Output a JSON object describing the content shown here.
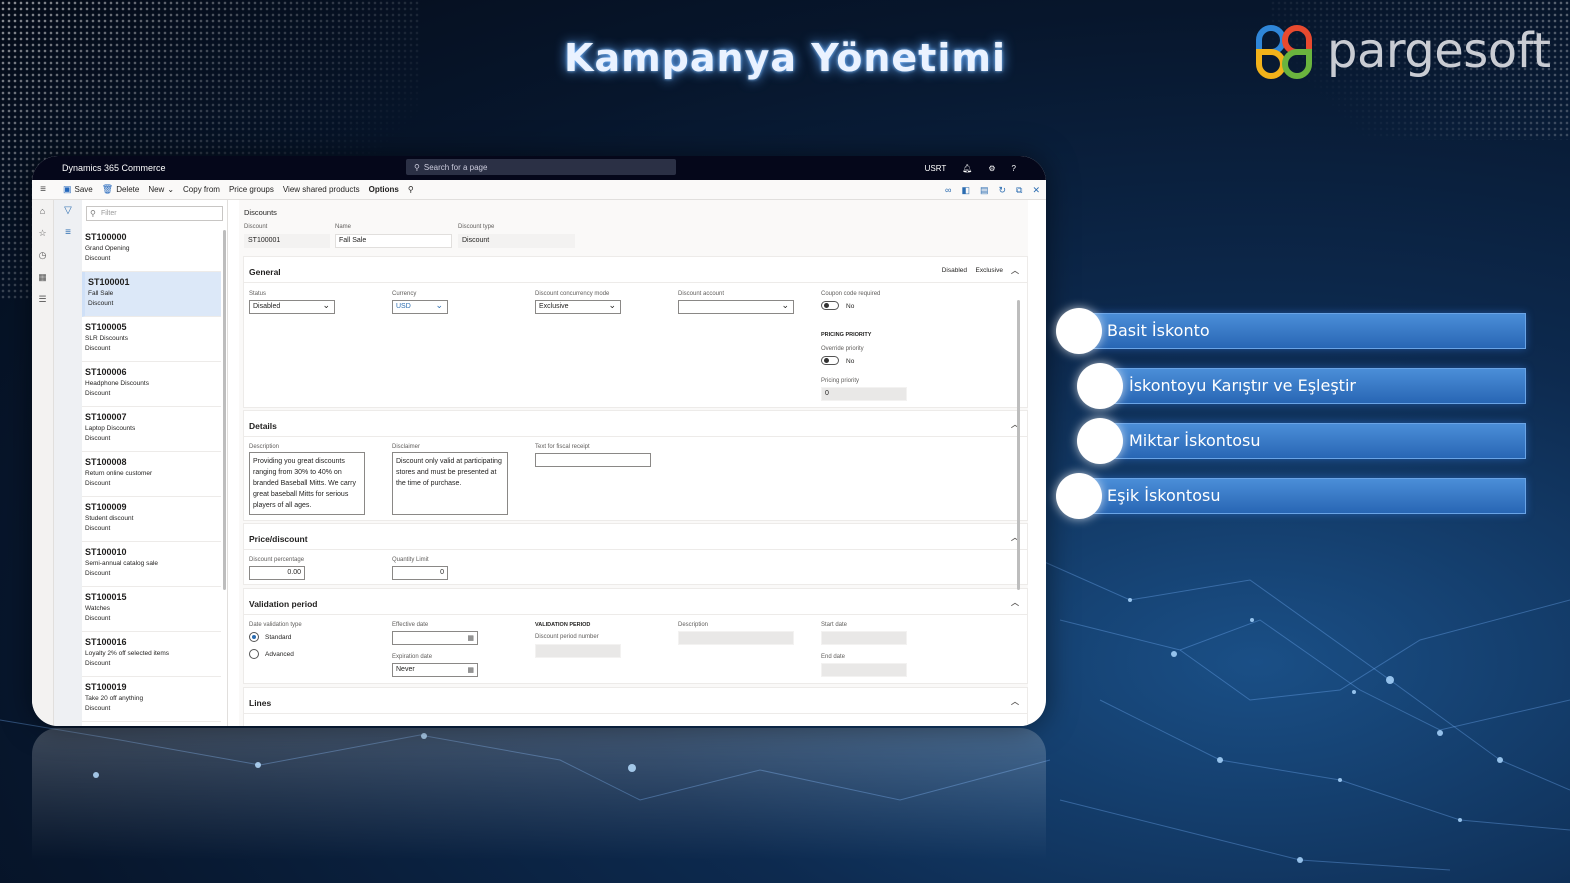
{
  "slide": {
    "title": "Kampanya Yönetimi",
    "logo_text": "pargesoft"
  },
  "app": {
    "name": "Dynamics 365 Commerce",
    "search_placeholder": "Search for a page",
    "user": "USRT"
  },
  "toolbar": {
    "save": "Save",
    "delete": "Delete",
    "new": "New",
    "copy_from": "Copy from",
    "price_groups": "Price groups",
    "view_shared": "View shared products",
    "options": "Options"
  },
  "list": {
    "filter_placeholder": "Filter",
    "items": [
      {
        "id": "ST100000",
        "name": "Grand Opening",
        "type": "Discount"
      },
      {
        "id": "ST100001",
        "name": "Fall Sale",
        "type": "Discount"
      },
      {
        "id": "ST100005",
        "name": "SLR Discounts",
        "type": "Discount"
      },
      {
        "id": "ST100006",
        "name": "Headphone Discounts",
        "type": "Discount"
      },
      {
        "id": "ST100007",
        "name": "Laptop Discounts",
        "type": "Discount"
      },
      {
        "id": "ST100008",
        "name": "Return online customer",
        "type": "Discount"
      },
      {
        "id": "ST100009",
        "name": "Student discount",
        "type": "Discount"
      },
      {
        "id": "ST100010",
        "name": "Semi-annual catalog sale",
        "type": "Discount"
      },
      {
        "id": "ST100015",
        "name": "Watches",
        "type": "Discount"
      },
      {
        "id": "ST100016",
        "name": "Loyalty 2% off selected items",
        "type": "Discount"
      },
      {
        "id": "ST100019",
        "name": "Take 20 off anything",
        "type": "Discount"
      }
    ]
  },
  "header": {
    "breadcrumb": "Discounts",
    "discount_label": "Discount",
    "discount_value": "ST100001",
    "name_label": "Name",
    "name_value": "Fall Sale",
    "type_label": "Discount type",
    "type_value": "Discount"
  },
  "general": {
    "title": "General",
    "badge1": "Disabled",
    "badge2": "Exclusive",
    "status_label": "Status",
    "status_value": "Disabled",
    "currency_label": "Currency",
    "currency_value": "USD",
    "concurrency_label": "Discount concurrency mode",
    "concurrency_value": "Exclusive",
    "account_label": "Discount account",
    "coupon_label": "Coupon code required",
    "coupon_value": "No",
    "pricing_priority_heading": "PRICING PRIORITY",
    "override_label": "Override priority",
    "override_value": "No",
    "priority_label": "Pricing priority",
    "priority_value": "0"
  },
  "details": {
    "title": "Details",
    "description_label": "Description",
    "description_value": "Providing you great discounts ranging from 30% to 40% on branded Baseball Mitts.  We carry great baseball Mitts for serious players of all ages.",
    "disclaimer_label": "Disclaimer",
    "disclaimer_value": "Discount only valid at participating stores and must be presented at the time of purchase.",
    "fiscal_label": "Text for fiscal receipt"
  },
  "price": {
    "title": "Price/discount",
    "pct_label": "Discount percentage",
    "pct_value": "0.00",
    "qty_label": "Quantity Limit",
    "qty_value": "0"
  },
  "validation": {
    "title": "Validation period",
    "type_label": "Date validation type",
    "standard": "Standard",
    "advanced": "Advanced",
    "effective_label": "Effective date",
    "expiration_label": "Expiration date",
    "expiration_value": "Never",
    "vp_heading": "VALIDATION PERIOD",
    "period_number_label": "Discount period number",
    "description_label": "Description",
    "start_label": "Start date",
    "end_label": "End date"
  },
  "lines": {
    "title": "Lines"
  },
  "menu": [
    {
      "label": "Basit İskonto"
    },
    {
      "label": "İskontoyu Karıştır ve Eşleştir"
    },
    {
      "label": "Miktar İskontosu"
    },
    {
      "label": "Eşik İskontosu"
    }
  ],
  "colors": {
    "accent": "#2b6cb0",
    "menu_bar": "#3a7bcc",
    "top_bar": "#05071a"
  }
}
